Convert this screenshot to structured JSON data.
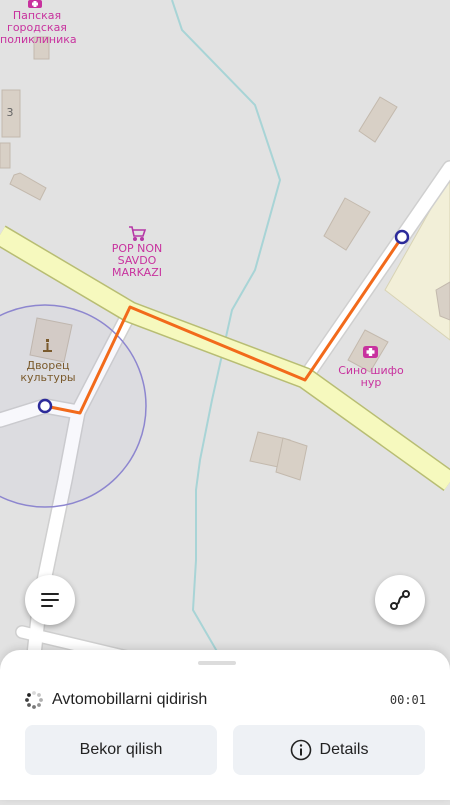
{
  "map": {
    "labels": {
      "polyclinic": "Папская городская поликлиника",
      "house_number": "3",
      "market": "POP NON SAVDO MARKAZI",
      "palace": "Дворец культуры",
      "pharmacy": "Сино шифо нур"
    }
  },
  "controls": {
    "menu_icon": "menu-icon",
    "route_icon": "route-icon"
  },
  "sheet": {
    "status_text": "Avtomobillarni qidirish",
    "timer": "00:01",
    "cancel_label": "Bekor qilish",
    "details_label": "Details",
    "details_icon": "info-icon",
    "spinner_icon": "spinner-icon"
  },
  "colors": {
    "route": "#f26a1b",
    "main_road_fill": "#f6f9be",
    "main_road_border": "#b8bd73",
    "stream": "#a8d4d6",
    "accuracy_circle": "#8d86cf",
    "pin": "#2c2a9a"
  }
}
